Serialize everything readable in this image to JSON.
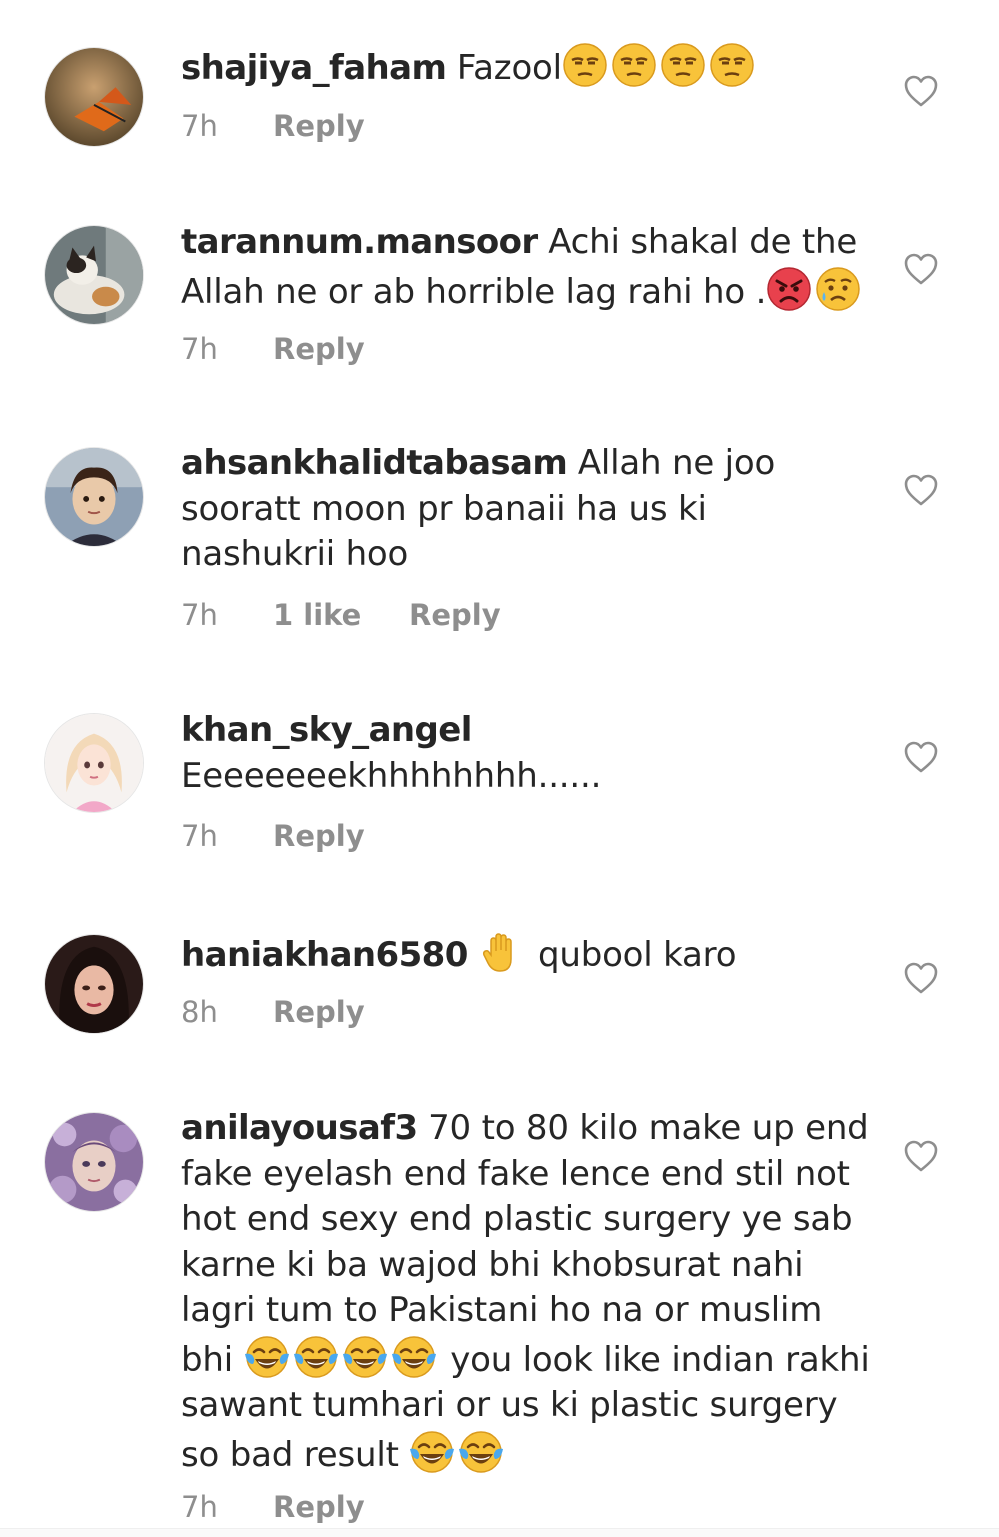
{
  "comments": [
    {
      "username": "shajiya_faham",
      "text": "Fazool",
      "emojis": [
        "unamused-face",
        "unamused-face",
        "unamused-face",
        "unamused-face"
      ],
      "time": "7h",
      "reply": "Reply"
    },
    {
      "username": "tarannum.mansoor",
      "text": "Achi shakal de the Allah ne or ab horrible lag rahi ho .",
      "emojis": [
        "angry-face",
        "sad-sweat-face"
      ],
      "time": "7h",
      "reply": "Reply"
    },
    {
      "username": "ahsankhalidtabasam",
      "text": "Allah ne joo sooratt moon pr banaii ha us ki nashukrii hoo",
      "time": "7h",
      "likes": "1 like",
      "reply": "Reply"
    },
    {
      "username": "khan_sky_angel",
      "text": "Eeeeeeeekhhhhhhhh......",
      "time": "7h",
      "reply": "Reply"
    },
    {
      "username": "haniakhan6580",
      "emojis": [
        "raised-hand"
      ],
      "text": "qubool karo",
      "time": "8h",
      "reply": "Reply"
    },
    {
      "username": "anilayousaf3",
      "text_part1": "70 to 80 kilo make up end fake eyelash end fake lence end stil not hot end sexy end plastic surgery ye sab karne ki ba wajod bhi khobsurat nahi lagri tum to Pakistani ho na or muslim bhi",
      "emojis_mid": [
        "tears-of-joy-face",
        "tears-of-joy-face",
        "tears-of-joy-face",
        "tears-of-joy-face"
      ],
      "text_part2": "you look like indian rakhi sawant tumhari or us ki plastic surgery so bad result",
      "emojis_end": [
        "tears-of-joy-face",
        "tears-of-joy-face"
      ],
      "time": "7h",
      "reply": "Reply"
    }
  ],
  "icons": {
    "heart": "heart-outline-icon"
  },
  "colors": {
    "text": "#262626",
    "meta": "#8e8e8e",
    "heart": "#8e8e8e",
    "emoji_yellow": "#f8c33a"
  }
}
